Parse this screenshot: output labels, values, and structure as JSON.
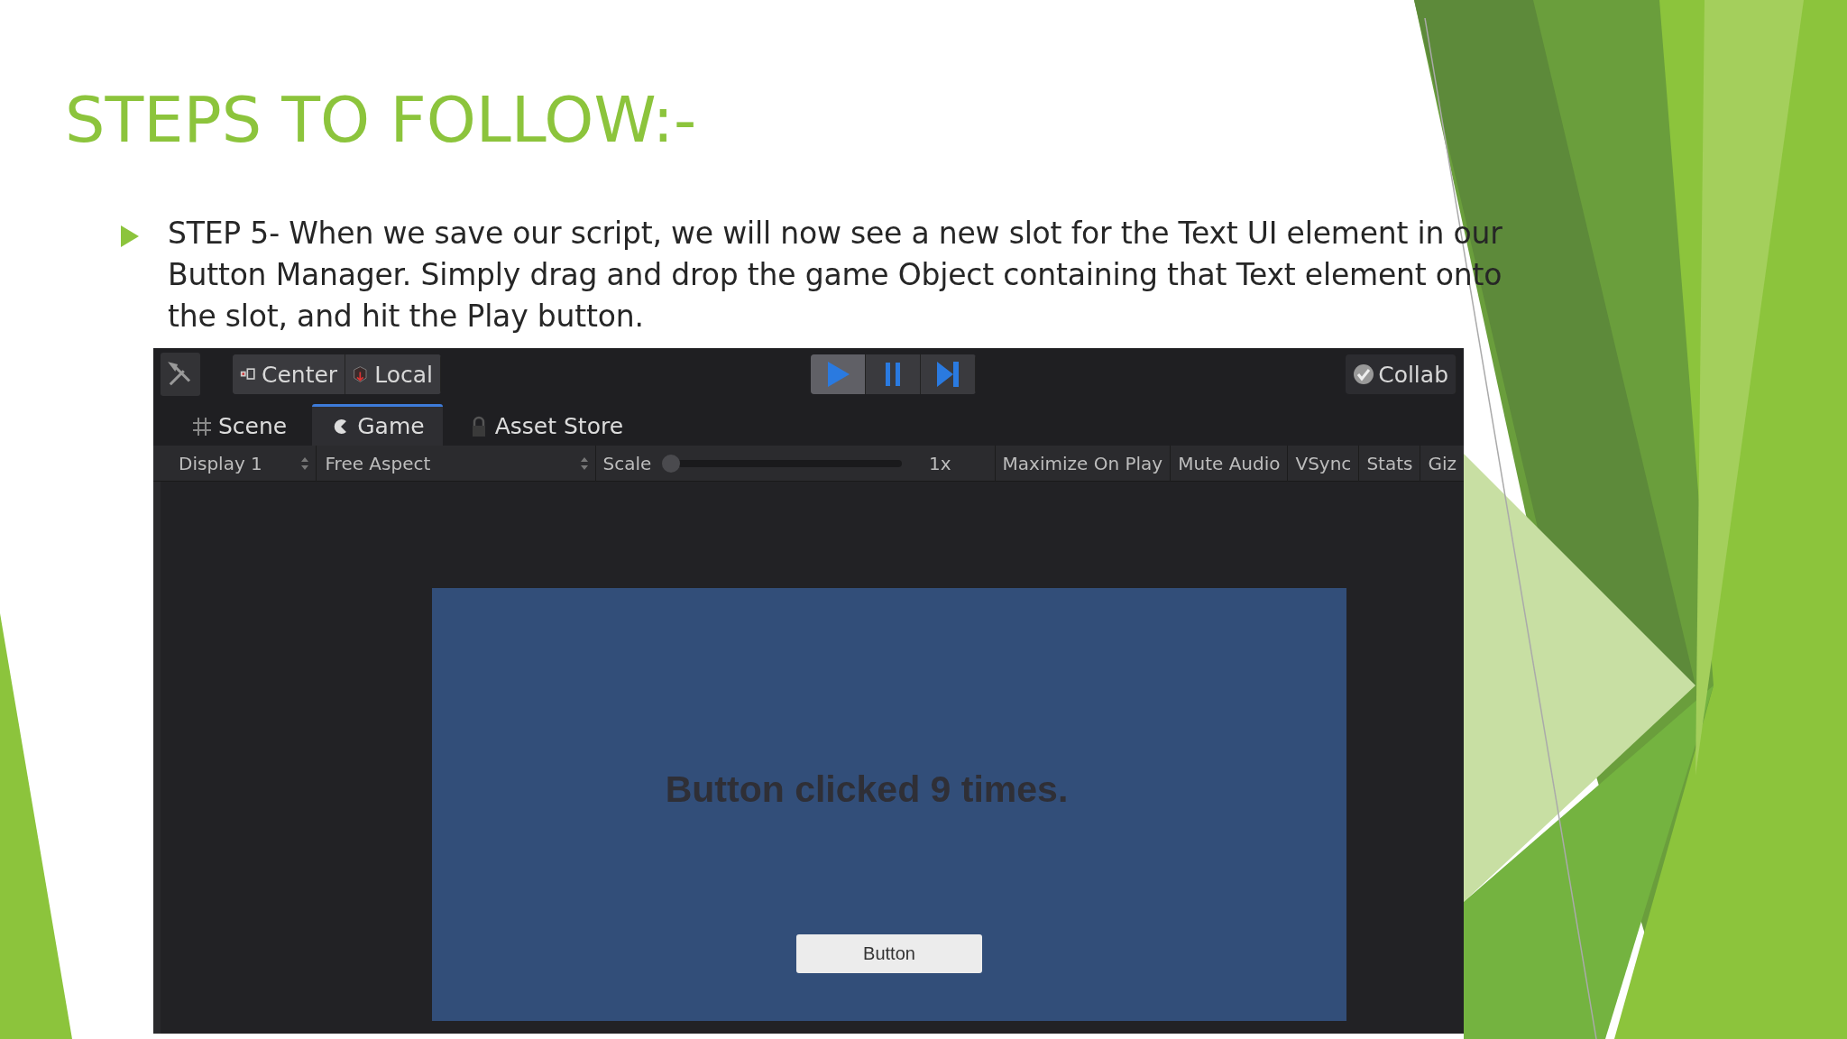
{
  "slide": {
    "title": "STEPS TO FOLLOW:-",
    "bullets": [
      "STEP 5- When we save our script, we will now see a new slot for the Text UI element in our Button Manager. Simply drag and drop the game Object containing that Text element onto the slot, and hit the Play button."
    ]
  },
  "editor": {
    "toolbar": {
      "pivot_buttons": [
        {
          "kind": "pivot",
          "label": "Center"
        },
        {
          "kind": "space",
          "label": "Local"
        }
      ],
      "play_controls": [
        {
          "kind": "play",
          "selected": true
        },
        {
          "kind": "pause",
          "selected": false
        },
        {
          "kind": "step",
          "selected": false
        }
      ],
      "collab": "Collab"
    },
    "tabs": [
      {
        "kind": "scene",
        "label": "Scene",
        "selected": false
      },
      {
        "kind": "game",
        "label": "Game",
        "selected": true
      },
      {
        "kind": "store",
        "label": "Asset Store",
        "selected": false
      }
    ],
    "game_bar": {
      "display": "Display 1",
      "aspect": "Free Aspect",
      "scale_label": "Scale",
      "scale": {
        "level": 0
      },
      "scale_reading": "1x",
      "toggles": [
        "Maximize On Play",
        "Mute Audio",
        "VSync",
        "Stats",
        "Giz"
      ]
    },
    "game_view": {
      "message": "Button clicked 9 times.",
      "button": "Button"
    }
  }
}
